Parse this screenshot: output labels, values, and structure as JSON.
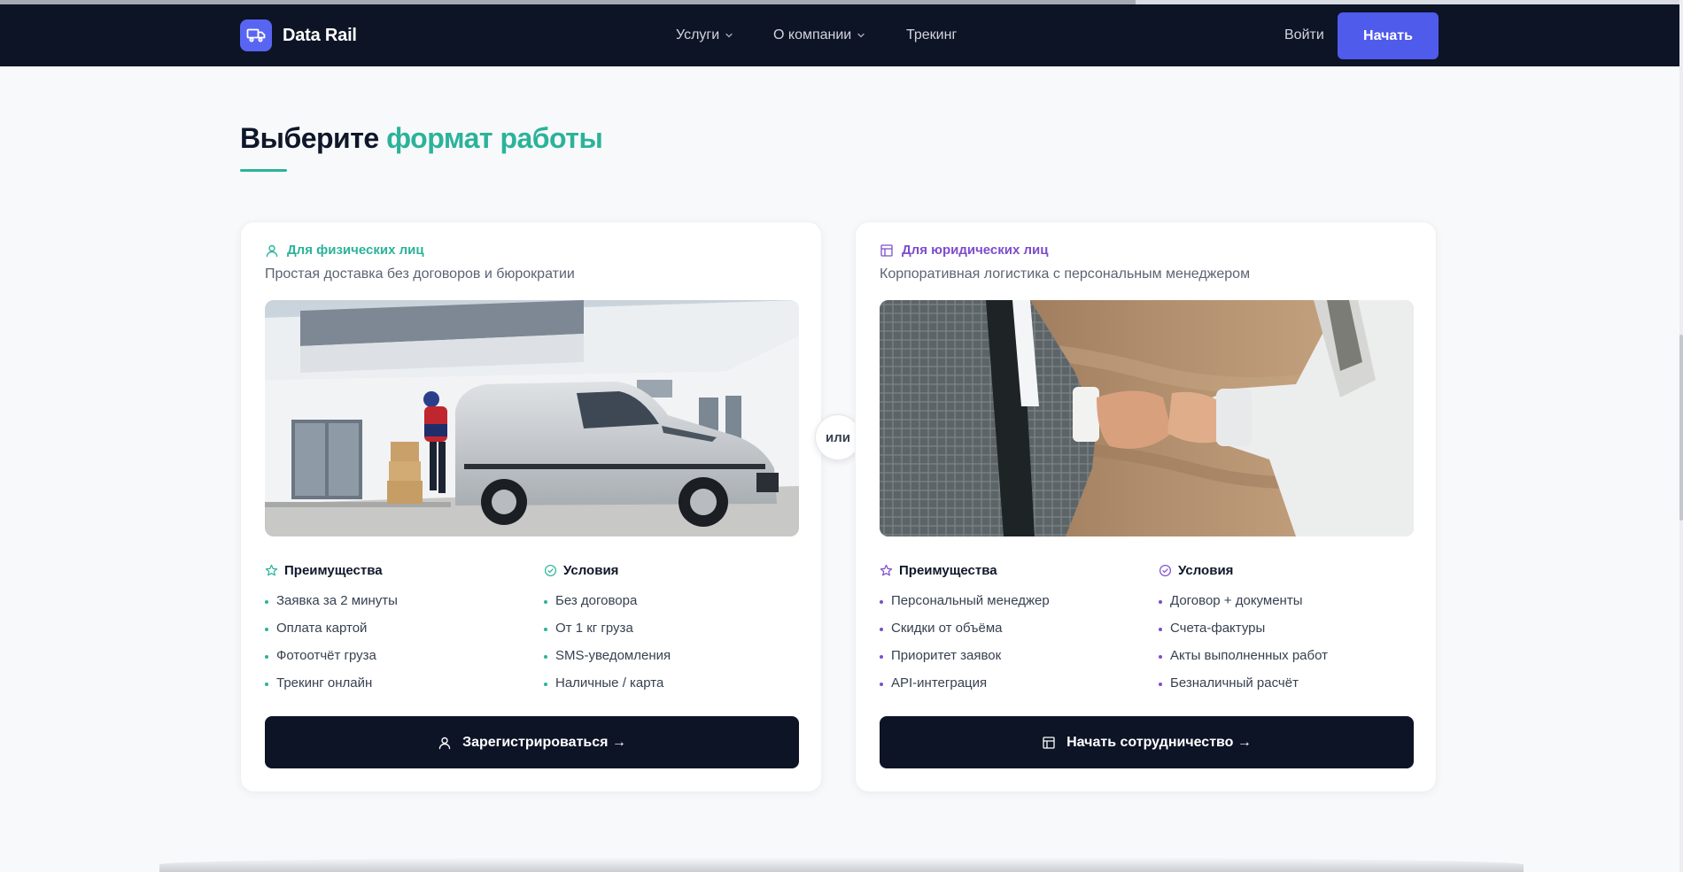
{
  "header": {
    "brand": "Data Rail",
    "nav": [
      {
        "label": "Услуги",
        "dropdown": true
      },
      {
        "label": "О компании",
        "dropdown": true
      },
      {
        "label": "Трекинг",
        "dropdown": false
      }
    ],
    "login_label": "Войти",
    "start_label": "Начать"
  },
  "section": {
    "title_part1": "Выберите",
    "title_accent": "формат работы"
  },
  "or_label": "или",
  "cards": [
    {
      "badge": "Для физических лиц",
      "badge_icon": "user-icon",
      "accent_color": "#2bb39a",
      "subtitle": "Простая доставка без договоров и бюрократии",
      "photo": "delivery-van-photo",
      "benefits_title": "Преимущества",
      "benefits": [
        "Заявка за 2 минуты",
        "Оплата картой",
        "Фотоотчёт груза",
        "Трекинг онлайн"
      ],
      "conditions_title": "Условия",
      "conditions": [
        "Без договора",
        "От 1 кг груза",
        "SMS-уведомления",
        "Наличные / карта"
      ],
      "cta": "Зарегистрироваться →"
    },
    {
      "badge": "Для юридических лиц",
      "badge_icon": "building-icon",
      "accent_color": "#7c4dcc",
      "subtitle": "Корпоративная логистика с персональным менеджером",
      "photo": "handshake-photo",
      "benefits_title": "Преимущества",
      "benefits": [
        "Персональный менеджер",
        "Скидки от объёма",
        "Приоритет заявок",
        "API-интеграция"
      ],
      "conditions_title": "Условия",
      "conditions": [
        "Договор + документы",
        "Счета-фактуры",
        "Акты выполненных работ",
        "Безналичный расчёт"
      ],
      "cta": "Начать сотрудничество →"
    }
  ],
  "colors": {
    "header_bg": "#0d1426",
    "brand_accent": "#4f5bea",
    "teal": "#2bb39a",
    "purple": "#7c4dcc",
    "page_bg": "#f8f9fb"
  }
}
